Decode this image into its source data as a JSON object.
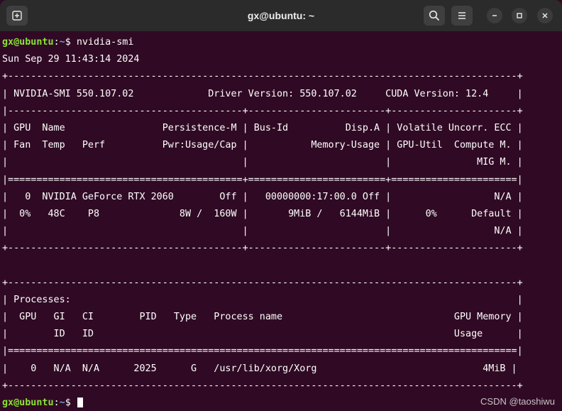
{
  "window": {
    "title": "gx@ubuntu: ~",
    "icons": {
      "new_tab": "new-tab-icon",
      "search": "search-icon",
      "menu": "hamburger-menu-icon",
      "minimize": "minimize-icon",
      "maximize": "maximize-icon",
      "close": "close-icon"
    }
  },
  "prompt": {
    "user_host": "gx@ubuntu",
    "colon": ":",
    "path": "~",
    "dollar": "$ "
  },
  "command": "nvidia-smi",
  "date_line": "Sun Sep 29 11:43:14 2024",
  "smi_lines": [
    "+-----------------------------------------------------------------------------------------+",
    "| NVIDIA-SMI 550.107.02             Driver Version: 550.107.02     CUDA Version: 12.4     |",
    "|-----------------------------------------+------------------------+----------------------+",
    "| GPU  Name                 Persistence-M | Bus-Id          Disp.A | Volatile Uncorr. ECC |",
    "| Fan  Temp   Perf          Pwr:Usage/Cap |           Memory-Usage | GPU-Util  Compute M. |",
    "|                                         |                        |               MIG M. |",
    "|=========================================+========================+======================|",
    "|   0  NVIDIA GeForce RTX 2060        Off |   00000000:17:00.0 Off |                  N/A |",
    "|  0%   48C    P8              8W /  160W |       9MiB /   6144MiB |      0%      Default |",
    "|                                         |                        |                  N/A |",
    "+-----------------------------------------+------------------------+----------------------+",
    "",
    "+-----------------------------------------------------------------------------------------+",
    "| Processes:                                                                              |",
    "|  GPU   GI   CI        PID   Type   Process name                              GPU Memory |",
    "|        ID   ID                                                               Usage      |",
    "|=========================================================================================|",
    "|    0   N/A  N/A      2025      G   /usr/lib/xorg/Xorg                             4MiB |",
    "+-----------------------------------------------------------------------------------------+"
  ],
  "watermark": "CSDN @taoshiwu"
}
